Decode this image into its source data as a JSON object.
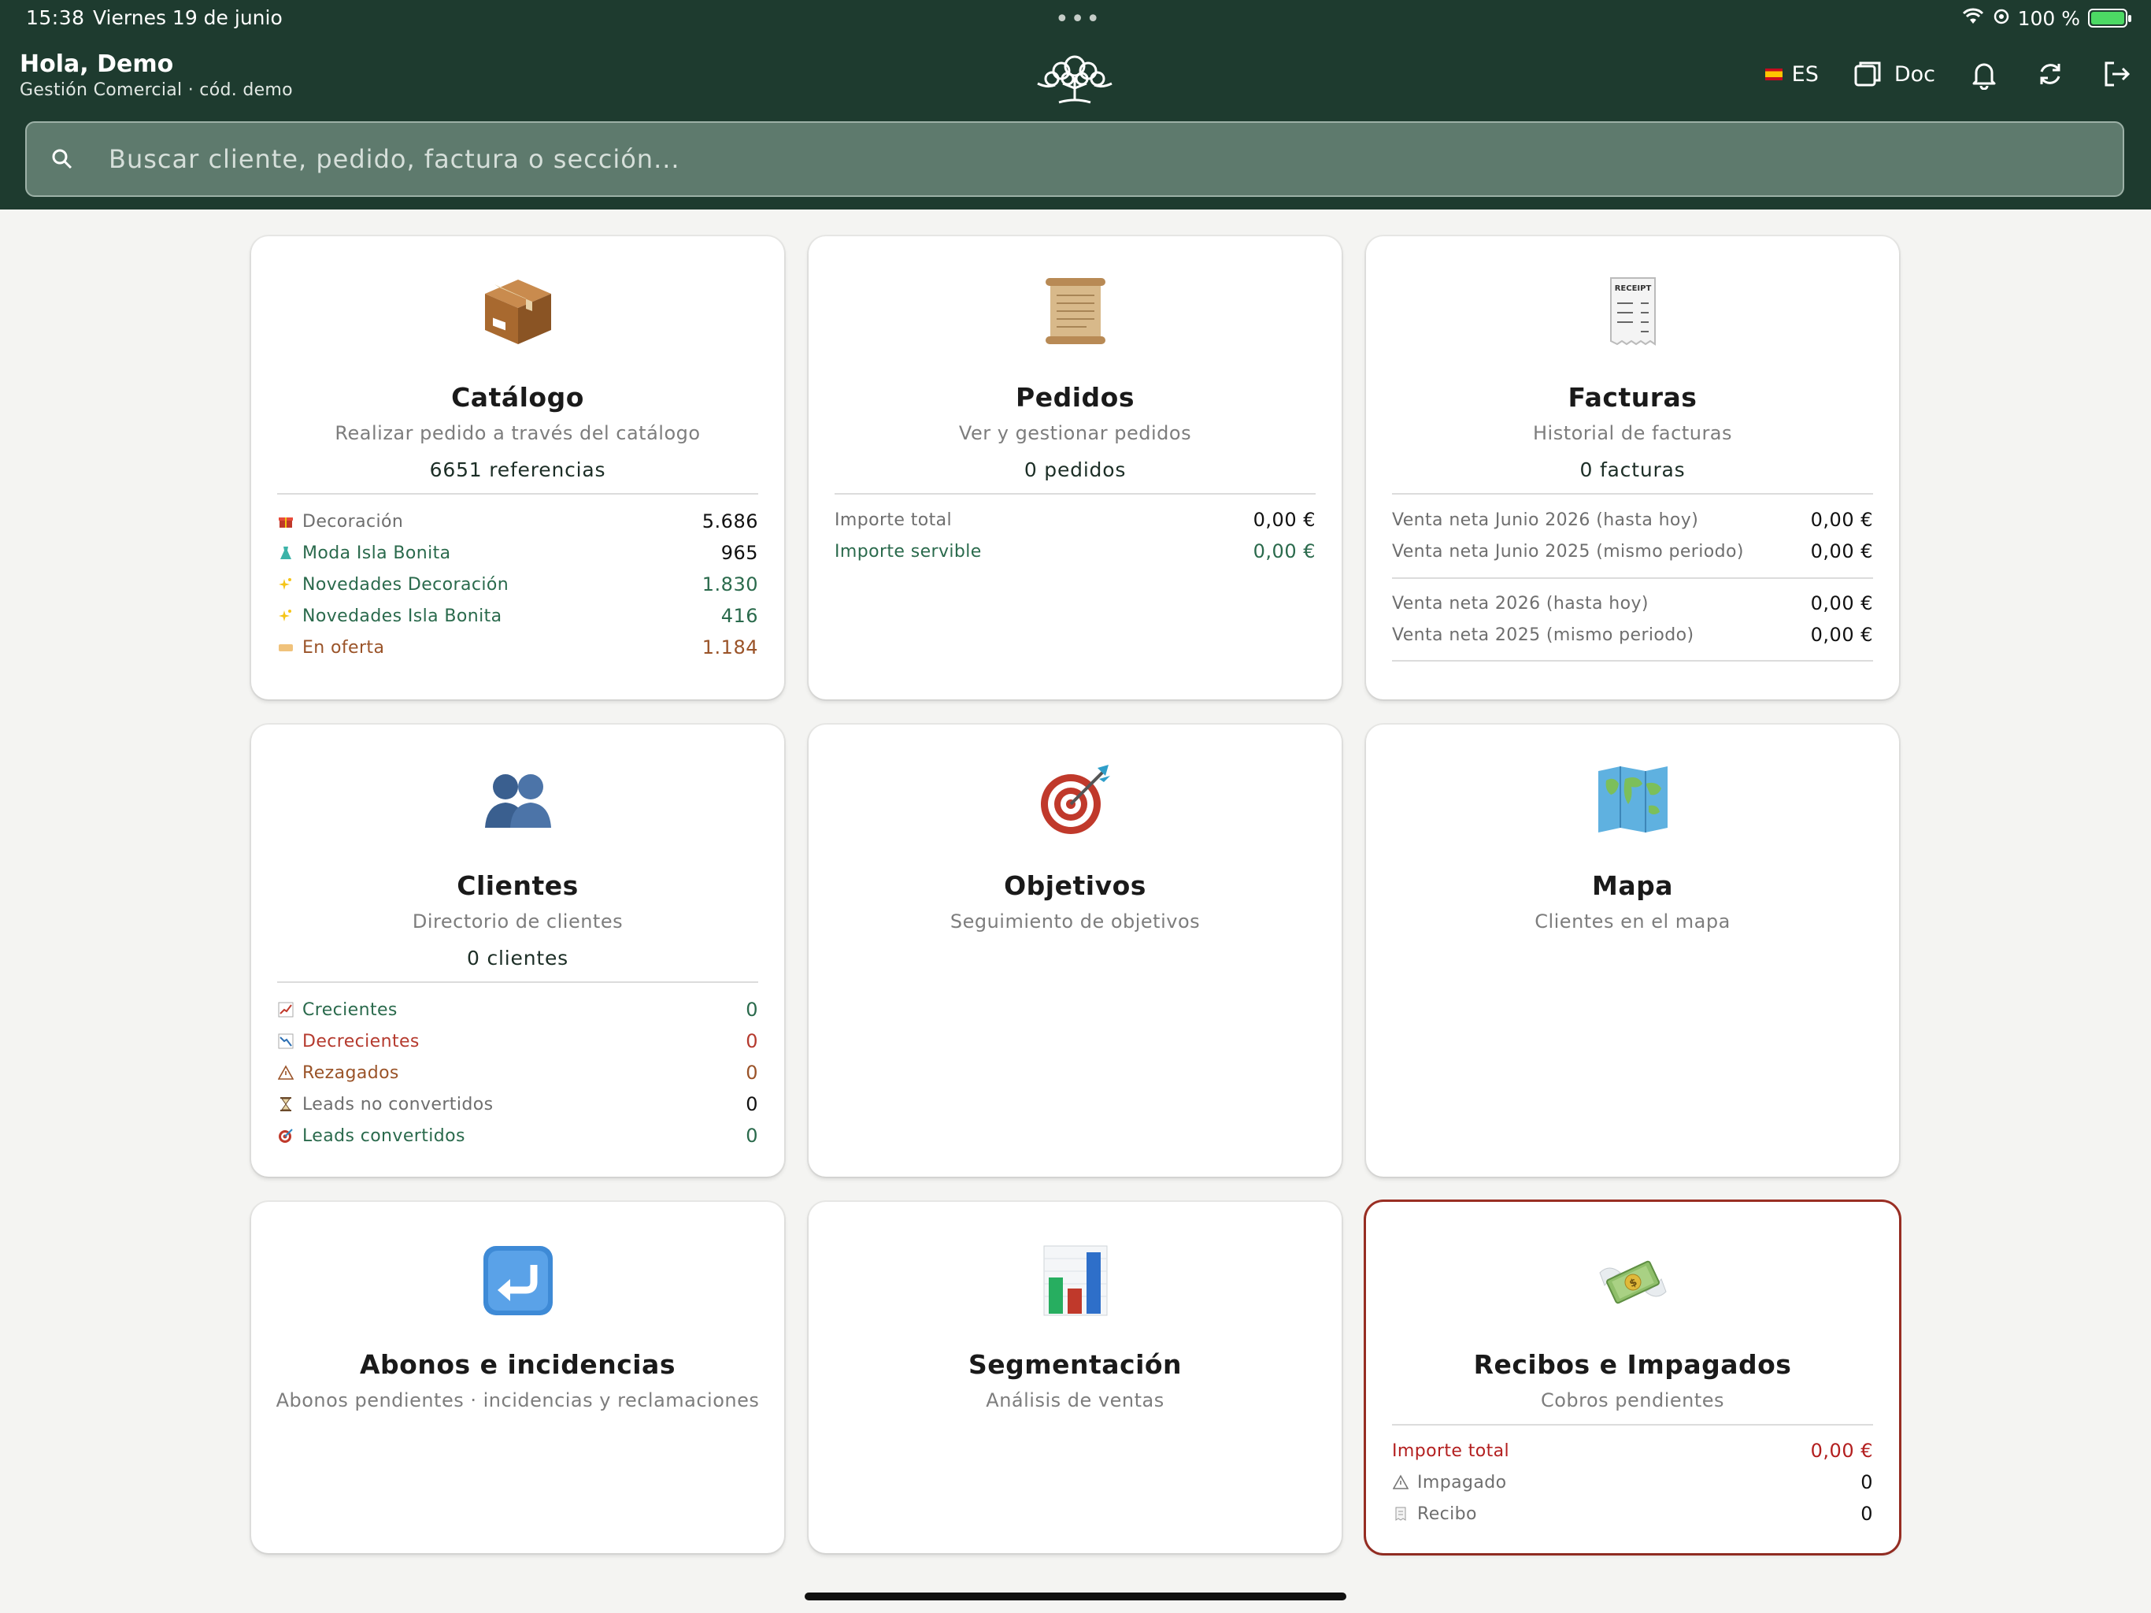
{
  "status": {
    "time": "15:38",
    "date": "Viernes 19 de junio",
    "battery": "100 %",
    "battery_level": 1.0
  },
  "header": {
    "greeting": "Hola, Demo",
    "subtitle": "Gestión Comercial · cód. demo",
    "language": "ES",
    "doc_label": "Doc",
    "icons": [
      "spain-flag-icon",
      "folder-icon",
      "bell-icon",
      "sync-icon",
      "logout-icon"
    ]
  },
  "search": {
    "placeholder": "Buscar cliente, pedido, factura o sección..."
  },
  "colors": {
    "header_bg": "#1e3b2f",
    "accent_green": "#2a6a4c",
    "alert_red": "#9b2f24"
  },
  "cards": {
    "catalogo": {
      "icon": "package-icon",
      "title": "Catálogo",
      "desc": "Realizar pedido a través del catálogo",
      "count": "6651 referencias",
      "rows": [
        {
          "label": "Decoración",
          "value": "5.686",
          "icon": "gift-icon"
        },
        {
          "label": "Moda Isla Bonita",
          "value": "965",
          "icon": "dress-icon"
        },
        {
          "label": "Novedades Decoración",
          "value": "1.830",
          "icon": "sparkles-icon"
        },
        {
          "label": "Novedades Isla Bonita",
          "value": "416",
          "icon": "sparkles-icon"
        },
        {
          "label": "En oferta",
          "value": "1.184",
          "icon": "ticket-icon"
        }
      ]
    },
    "pedidos": {
      "icon": "scroll-icon",
      "title": "Pedidos",
      "desc": "Ver y gestionar pedidos",
      "count": "0 pedidos",
      "rows": [
        {
          "label": "Importe total",
          "value": "0,00 €"
        },
        {
          "label": "Importe servible",
          "value": "0,00 €"
        }
      ]
    },
    "facturas": {
      "icon": "receipt-icon",
      "title": "Facturas",
      "desc": "Historial de facturas",
      "count": "0 facturas",
      "rows": [
        {
          "label": "Venta neta Junio 2026 (hasta hoy)",
          "value": "0,00 €"
        },
        {
          "label": "Venta neta Junio 2025 (mismo periodo)",
          "value": "0,00 €"
        },
        {
          "label": "Venta neta 2026 (hasta hoy)",
          "value": "0,00 €"
        },
        {
          "label": "Venta neta 2025 (mismo periodo)",
          "value": "0,00 €"
        }
      ]
    },
    "clientes": {
      "icon": "people-icon",
      "title": "Clientes",
      "desc": "Directorio de clientes",
      "count": "0 clientes",
      "rows": [
        {
          "label": "Crecientes",
          "value": "0",
          "icon": "chart-up-icon"
        },
        {
          "label": "Decrecientes",
          "value": "0",
          "icon": "chart-down-icon"
        },
        {
          "label": "Rezagados",
          "value": "0",
          "icon": "warning-icon"
        },
        {
          "label": "Leads no convertidos",
          "value": "0",
          "icon": "hourglass-icon"
        },
        {
          "label": "Leads convertidos",
          "value": "0",
          "icon": "target-icon"
        }
      ]
    },
    "objetivos": {
      "icon": "target-icon",
      "title": "Objetivos",
      "desc": "Seguimiento de objetivos"
    },
    "mapa": {
      "icon": "world-map-icon",
      "title": "Mapa",
      "desc": "Clientes en el mapa"
    },
    "abonos": {
      "icon": "return-arrow-icon",
      "title": "Abonos e incidencias",
      "desc": "Abonos pendientes · incidencias y reclamaciones"
    },
    "segmentacion": {
      "icon": "bar-chart-icon",
      "title": "Segmentación",
      "desc": "Análisis de ventas"
    },
    "recibos": {
      "icon": "money-wings-icon",
      "title": "Recibos e Impagados",
      "desc": "Cobros pendientes",
      "rows": [
        {
          "label": "Importe total",
          "value": "0,00 €"
        },
        {
          "label": "Impagado",
          "value": "0",
          "icon": "warning-icon"
        },
        {
          "label": "Recibo",
          "value": "0",
          "icon": "receipt-icon"
        }
      ]
    }
  }
}
